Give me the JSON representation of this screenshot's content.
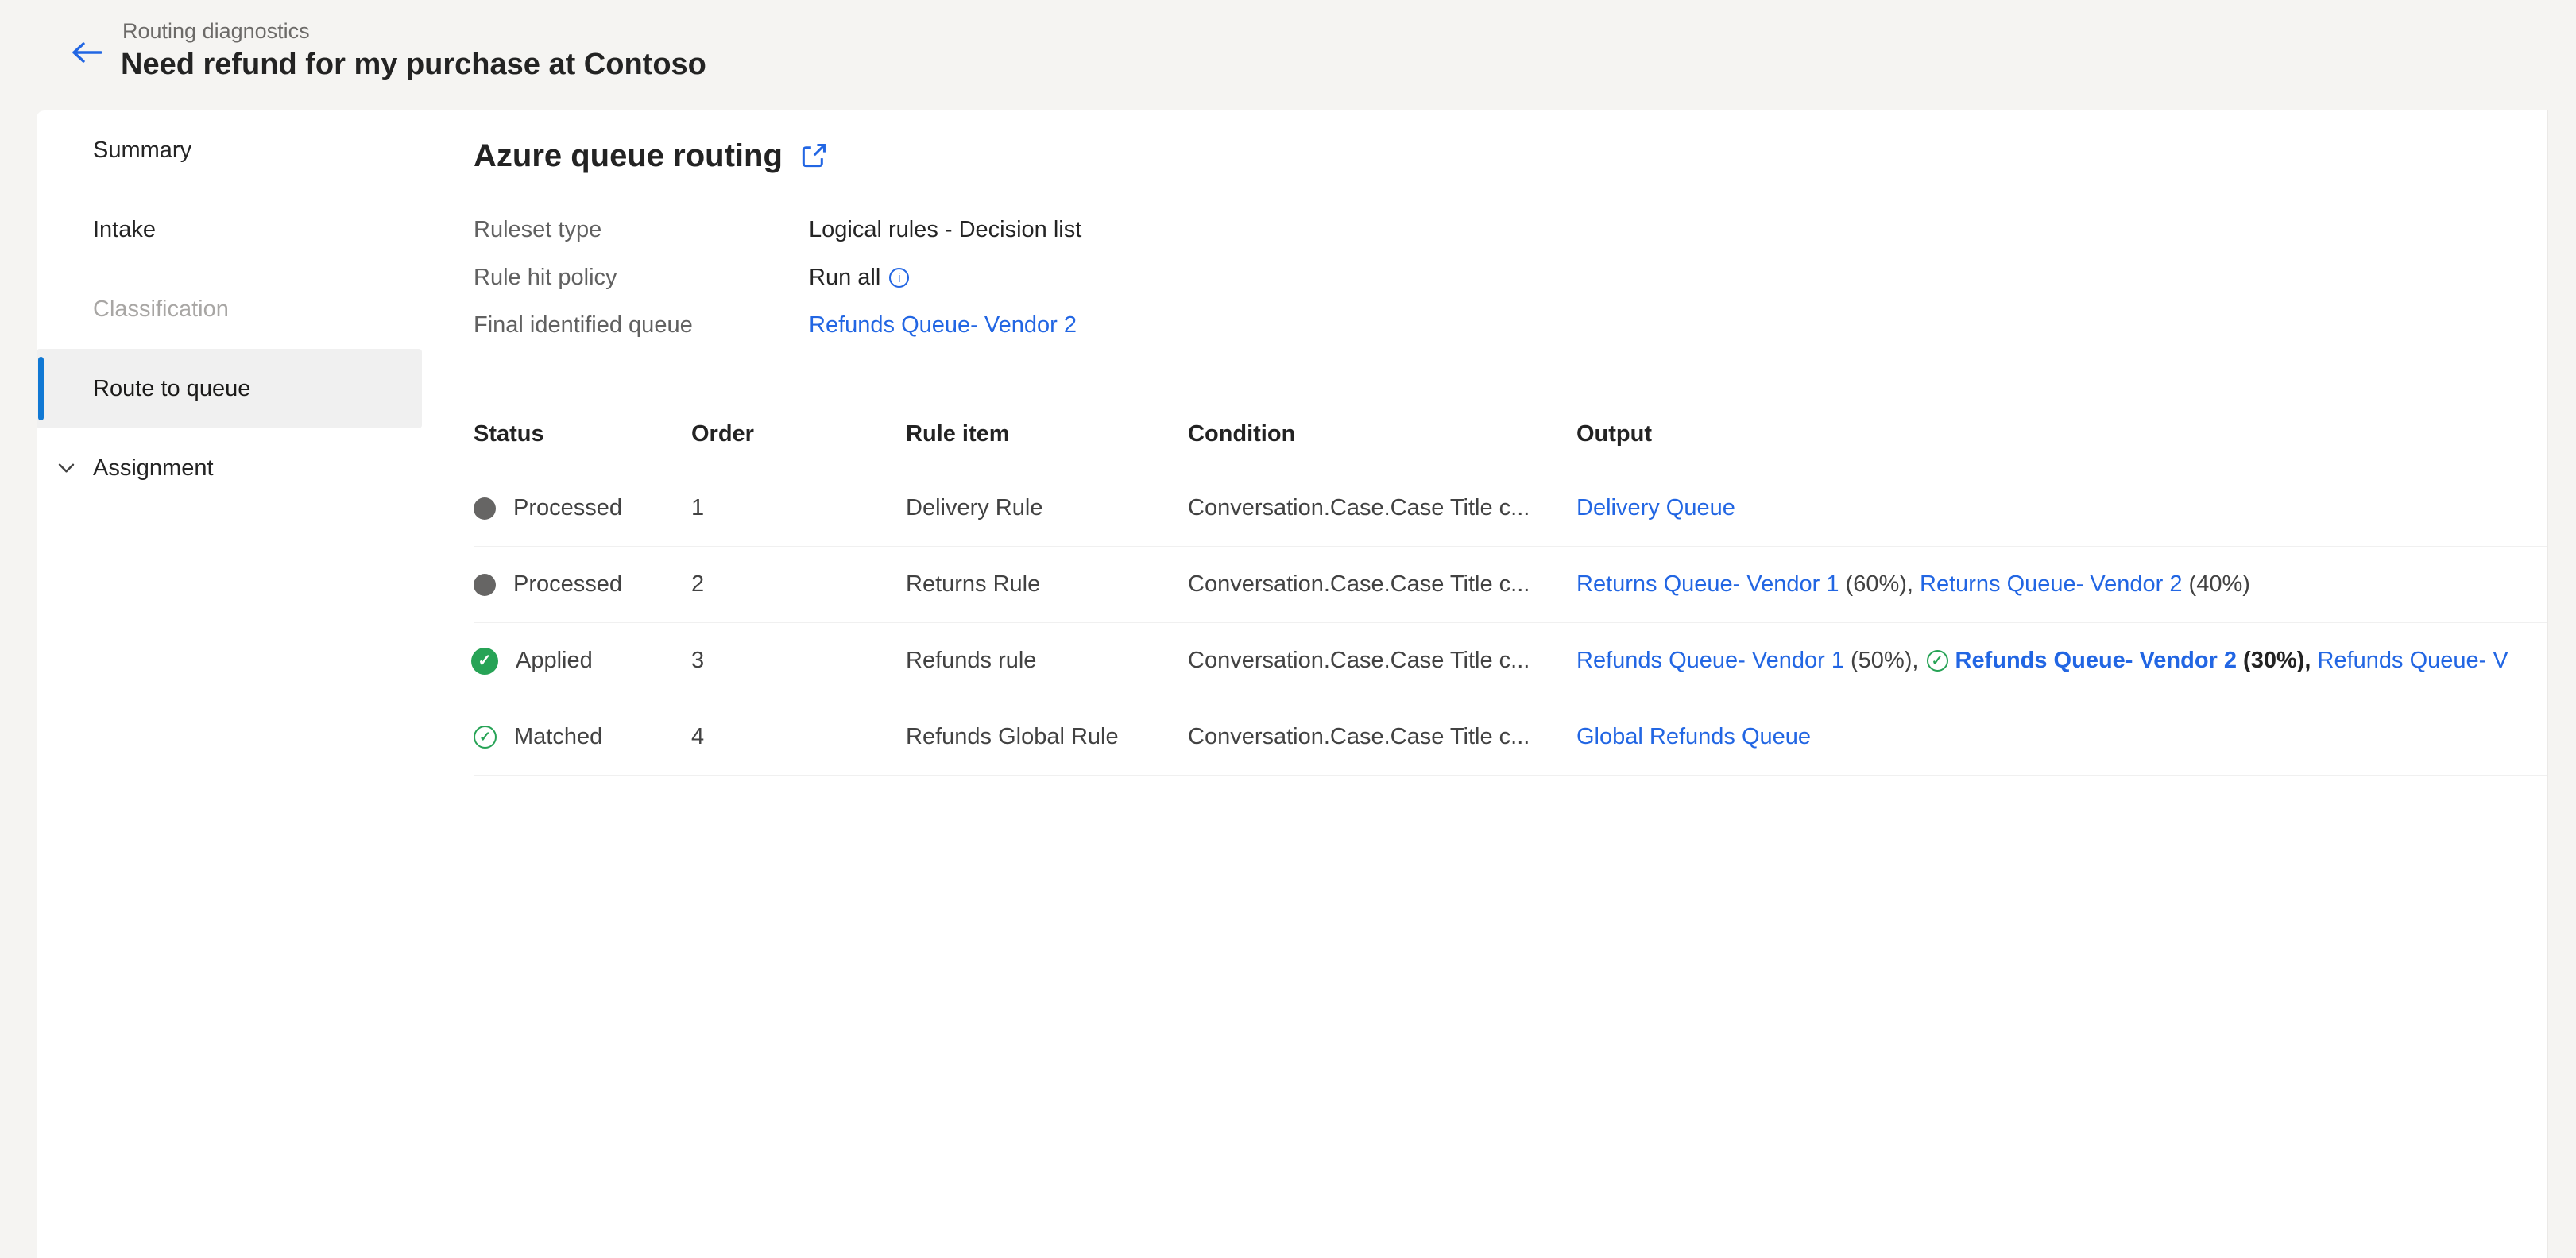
{
  "colors": {
    "accent_blue": "#1078d4",
    "link_blue": "#2266e3",
    "success_green": "#27a356",
    "neutral_dot_gray": "#666564"
  },
  "header": {
    "breadcrumb": "Routing diagnostics",
    "title": "Need refund for my purchase at Contoso",
    "back_icon": "arrow-left-icon"
  },
  "sidebar": {
    "items": [
      {
        "id": "summary",
        "label": "Summary",
        "state": "normal"
      },
      {
        "id": "intake",
        "label": "Intake",
        "state": "normal"
      },
      {
        "id": "classification",
        "label": "Classification",
        "state": "disabled"
      },
      {
        "id": "route-to-queue",
        "label": "Route to queue",
        "state": "selected"
      },
      {
        "id": "assignment",
        "label": "Assignment",
        "state": "collapsible",
        "icon": "chevron-down-icon"
      }
    ]
  },
  "main": {
    "title": "Azure queue routing",
    "title_icon": "open-in-new-window-icon",
    "details": [
      {
        "label": "Ruleset type",
        "value": "Logical rules - Decision list",
        "value_type": "text"
      },
      {
        "label": "Rule hit policy",
        "value": "Run all",
        "value_type": "text",
        "suffix_icon": "info-icon"
      },
      {
        "label": "Final identified queue",
        "value": "Refunds Queue- Vendor 2",
        "value_type": "link"
      }
    ],
    "table": {
      "columns": [
        "Status",
        "Order",
        "Rule item",
        "Condition",
        "Output"
      ],
      "rows": [
        {
          "status": {
            "icon": "status-dot-gray-icon",
            "label": "Processed"
          },
          "order": "1",
          "rule_item": "Delivery Rule",
          "condition": "Conversation.Case.Case Title c...",
          "output": [
            {
              "kind": "link",
              "text": "Delivery Queue"
            }
          ]
        },
        {
          "status": {
            "icon": "status-dot-gray-icon",
            "label": "Processed"
          },
          "order": "2",
          "rule_item": "Returns Rule",
          "condition": "Conversation.Case.Case Title c...",
          "output": [
            {
              "kind": "link",
              "text": "Returns Queue- Vendor 1"
            },
            {
              "kind": "text",
              "text": " (60%), "
            },
            {
              "kind": "link",
              "text": "Returns Queue- Vendor 2"
            },
            {
              "kind": "text",
              "text": " (40%)"
            }
          ]
        },
        {
          "status": {
            "icon": "status-check-filled-icon",
            "label": "Applied"
          },
          "order": "3",
          "rule_item": "Refunds rule",
          "condition": "Conversation.Case.Case Title c...",
          "output": [
            {
              "kind": "link",
              "text": "Refunds Queue- Vendor 1"
            },
            {
              "kind": "text",
              "text": " (50%), "
            },
            {
              "kind": "icon",
              "icon": "check-circle-outline-icon"
            },
            {
              "kind": "link-bold",
              "text": "Refunds Queue- Vendor 2"
            },
            {
              "kind": "text-bold",
              "text": " (30%), "
            },
            {
              "kind": "link",
              "text": "Refunds Queue- V"
            }
          ]
        },
        {
          "status": {
            "icon": "status-check-outline-icon",
            "label": "Matched"
          },
          "order": "4",
          "rule_item": "Refunds Global Rule",
          "condition": "Conversation.Case.Case Title c...",
          "output": [
            {
              "kind": "link",
              "text": "Global Refunds Queue"
            }
          ]
        }
      ]
    }
  }
}
